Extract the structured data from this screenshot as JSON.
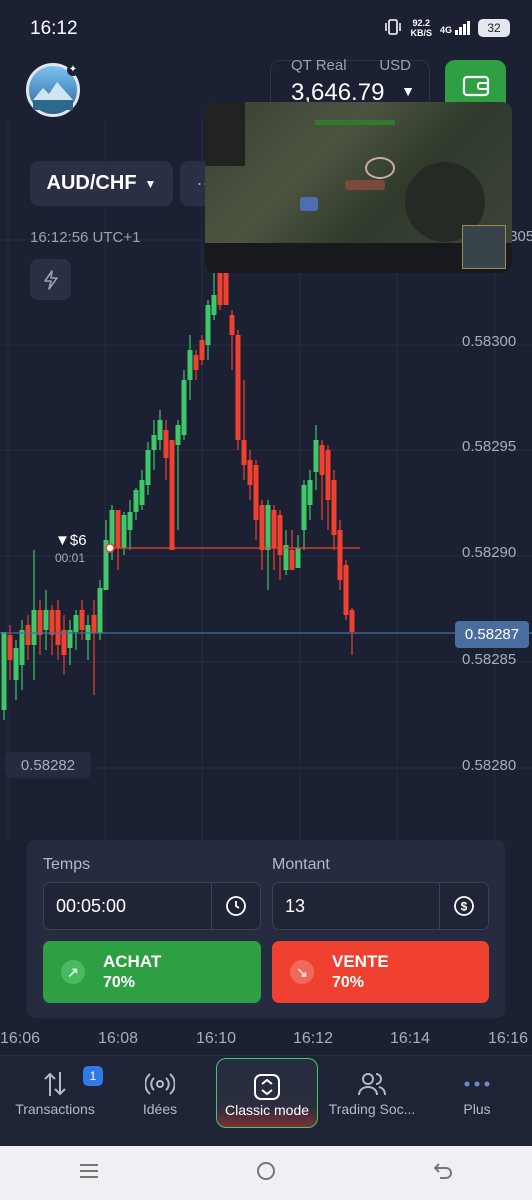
{
  "status_bar": {
    "time": "16:12",
    "net_speed": "92.2",
    "net_unit": "KB/S",
    "network": "4G",
    "battery": "32"
  },
  "header": {
    "account": "QT Real",
    "currency": "USD",
    "balance": "3,646.79"
  },
  "pair": {
    "name": "AUD/CHF"
  },
  "clock": "16:12:56 UTC+1",
  "chart": {
    "price_labels": [
      "0.58305",
      "0.58300",
      "0.58295",
      "0.58290",
      "0.58285",
      "0.58280"
    ],
    "current_price": "0.58287",
    "low_price": "0.58282",
    "trade_amount": "▼$6",
    "trade_timer": "00:01",
    "time_labels": [
      "16:06",
      "16:08",
      "16:10",
      "16:12",
      "16:14",
      "16:16"
    ],
    "up_color": "#3fc76a",
    "down_color": "#f0402f"
  },
  "panel": {
    "time_label": "Temps",
    "time_value": "00:05:00",
    "amount_label": "Montant",
    "amount_value": "13",
    "buy_label": "ACHAT",
    "buy_pct": "70%",
    "sell_label": "VENTE",
    "sell_pct": "70%"
  },
  "nav": {
    "transactions": "Transactions",
    "transactions_badge": "1",
    "ideas": "Idées",
    "classic": "Classic mode",
    "social": "Trading Soc...",
    "more": "Plus"
  }
}
